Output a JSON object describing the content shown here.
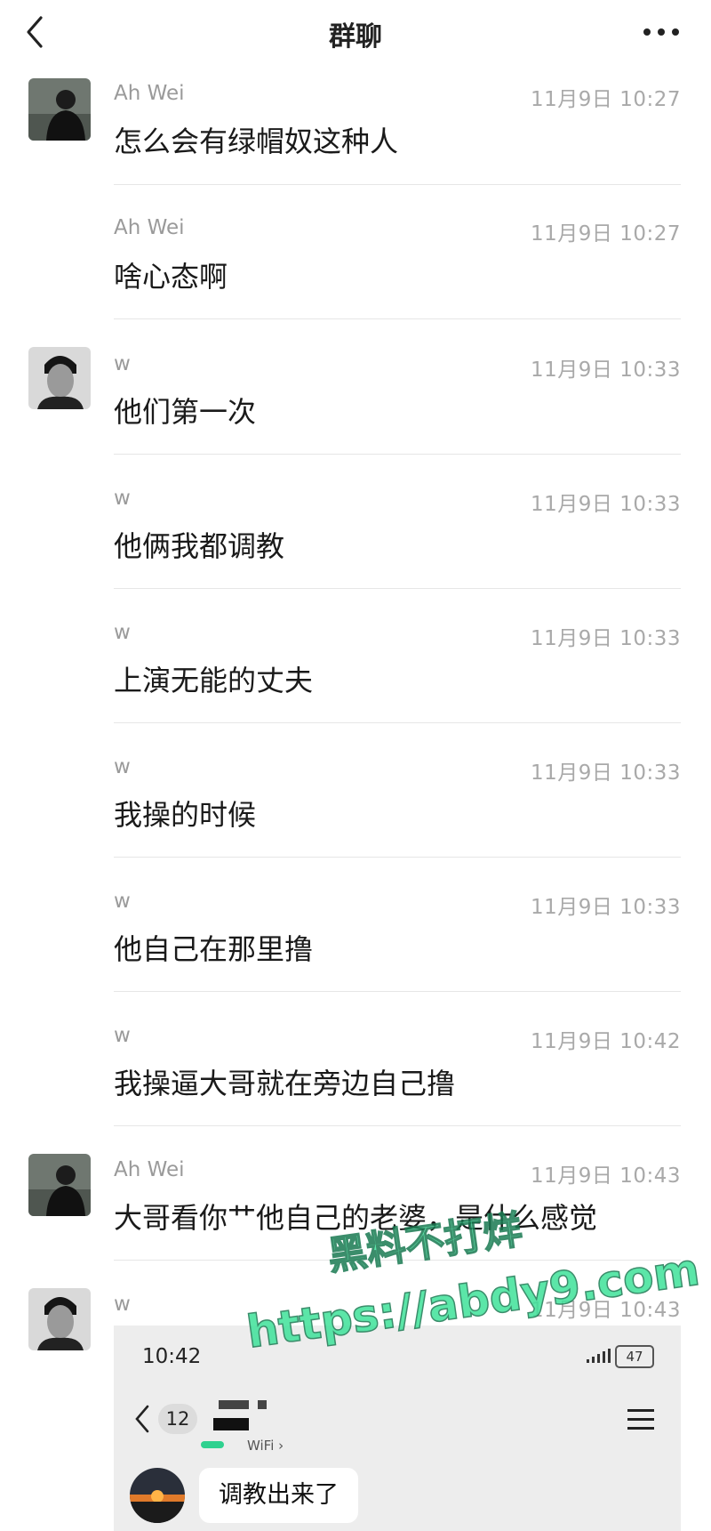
{
  "header": {
    "title": "群聊"
  },
  "messages": [
    {
      "sender": "Ah Wei",
      "time": "11月9日 10:27",
      "text": "怎么会有绿帽奴这种人",
      "avatar": "man-in-black-avatar"
    },
    {
      "sender": "Ah Wei",
      "time": "11月9日 10:27",
      "text": "啥心态啊"
    },
    {
      "sender": "w",
      "time": "11月9日 10:33",
      "text": "他们第一次",
      "avatar": "man-portrait-avatar"
    },
    {
      "sender": "w",
      "time": "11月9日 10:33",
      "text": "他俩我都调教"
    },
    {
      "sender": "w",
      "time": "11月9日 10:33",
      "text": "上演无能的丈夫"
    },
    {
      "sender": "w",
      "time": "11月9日 10:33",
      "text": "我操的时候"
    },
    {
      "sender": "w",
      "time": "11月9日 10:33",
      "text": "他自己在那里撸"
    },
    {
      "sender": "w",
      "time": "11月9日 10:42",
      "text": "我操逼大哥就在旁边自己撸"
    },
    {
      "sender": "Ah Wei",
      "time": "11月9日 10:43",
      "text": "大哥看你艹他自己的老婆，是什么感觉",
      "avatar": "man-in-black-avatar"
    },
    {
      "sender": "w",
      "time": "11月9日 10:43",
      "text": "",
      "avatar": "man-portrait-avatar"
    }
  ],
  "embedded_screenshot": {
    "clock": "10:42",
    "battery": "47",
    "unread_badge": "12",
    "network": "WiFi ›",
    "message": "调教出来了"
  },
  "watermark": {
    "line1": "黑料不打烊",
    "line2": "https://abdy9.com",
    "color": "#3fe29a"
  }
}
